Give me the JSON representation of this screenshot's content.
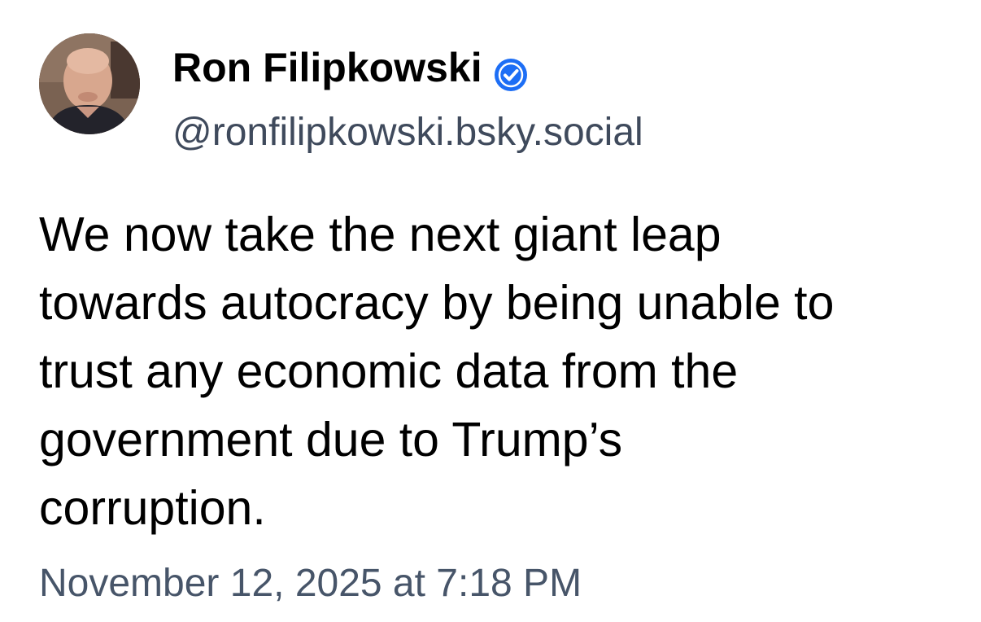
{
  "post": {
    "author": {
      "display_name": "Ron Filipkowski",
      "handle": "@ronfilipkowski.bsky.social",
      "verified": true,
      "avatar_icon": "avatar-photo",
      "badge_icon": "verified-check-icon",
      "badge_color": "#1d6ef5"
    },
    "text_lines": [
      "We now take the next giant leap",
      "towards autocracy by being unable to",
      "trust any economic data from the",
      "government due to Trump’s",
      "corruption."
    ],
    "timestamp": "November 12, 2025 at 7:18 PM"
  },
  "colors": {
    "background": "#ffffff",
    "text": "#000000",
    "handle": "#3f4a5c",
    "timestamp": "#475569"
  }
}
